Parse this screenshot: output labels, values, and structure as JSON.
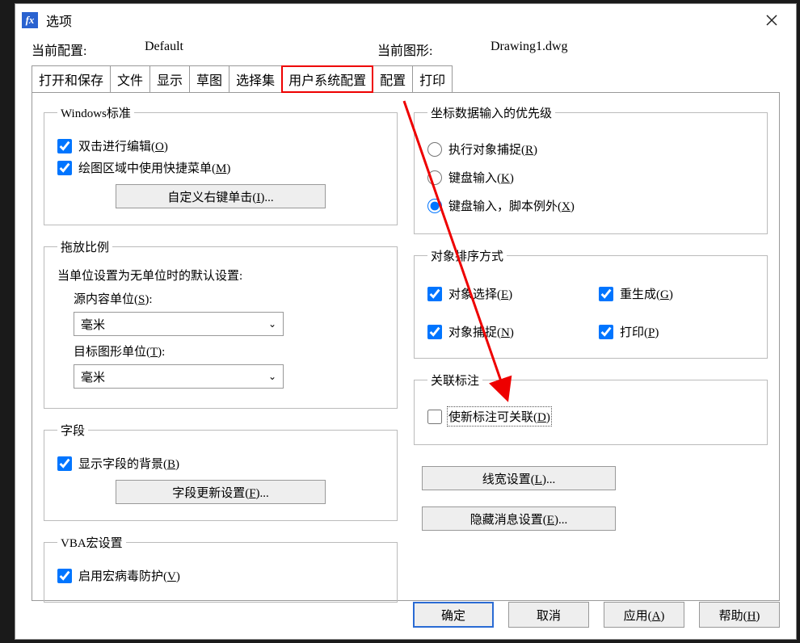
{
  "window": {
    "title": "选项",
    "icon": "fx"
  },
  "info": {
    "current_profile_label": "当前配置:",
    "current_profile_value": "Default",
    "current_drawing_label": "当前图形:",
    "current_drawing_value": "Drawing1.dwg"
  },
  "tabs": [
    "打开和保存",
    "文件",
    "显示",
    "草图",
    "选择集",
    "用户系统配置",
    "配置",
    "打印"
  ],
  "left": {
    "windows_standard": {
      "legend": "Windows标准",
      "double_click_edit": "双击进行编辑(O)",
      "shortcut_menu": "绘图区域中使用快捷菜单(M)",
      "custom_right_click_btn": "自定义右键单击(I)..."
    },
    "insert_scale": {
      "legend": "拖放比例",
      "note": "当单位设置为无单位时的默认设置:",
      "source_unit_label": "源内容单位(S):",
      "source_unit_value": "毫米",
      "target_unit_label": "目标图形单位(T):",
      "target_unit_value": "毫米"
    },
    "fields": {
      "legend": "字段",
      "show_bg": "显示字段的背景(B)",
      "update_btn": "字段更新设置(F)..."
    },
    "vba": {
      "legend": "VBA宏设置",
      "enable_protect": "启用宏病毒防护(V)"
    }
  },
  "right": {
    "coord_priority": {
      "legend": "坐标数据输入的优先级",
      "opt1": "执行对象捕捉(R)",
      "opt2": "键盘输入(K)",
      "opt3": "键盘输入，脚本例外(X)"
    },
    "sort_method": {
      "legend": "对象排序方式",
      "c1": "对象选择(E)",
      "c2": "重生成(G)",
      "c3": "对象捕捉(N)",
      "c4": "打印(P)"
    },
    "assoc_dim": {
      "legend": "关联标注",
      "check": "使新标注可关联(D)"
    },
    "btn_lineweight": "线宽设置(L)...",
    "btn_hidden_msg": "隐藏消息设置(E)..."
  },
  "buttons": {
    "ok": "确定",
    "cancel": "取消",
    "apply": "应用(A)",
    "help": "帮助(H)"
  }
}
